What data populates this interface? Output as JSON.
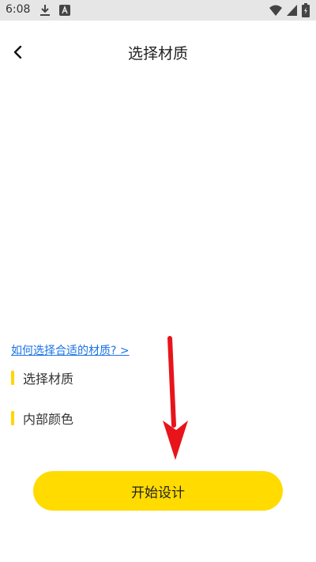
{
  "status_bar": {
    "time": "6:08",
    "icons": [
      "download-icon",
      "a-icon",
      "wifi-icon",
      "signal-icon",
      "battery-icon"
    ]
  },
  "header": {
    "title": "选择材质",
    "back_icon": "chevron-left-icon"
  },
  "main": {
    "help_link": "如何选择合适的材质? >",
    "sections": [
      {
        "label": "选择材质"
      },
      {
        "label": "内部颜色"
      }
    ]
  },
  "footer": {
    "start_label": "开始设计"
  },
  "colors": {
    "accent": "#ffdb00",
    "section_bar": "#ffd600",
    "link": "#1a73e8",
    "arrow": "#e8141b",
    "status_bg": "#e6e6e6"
  }
}
